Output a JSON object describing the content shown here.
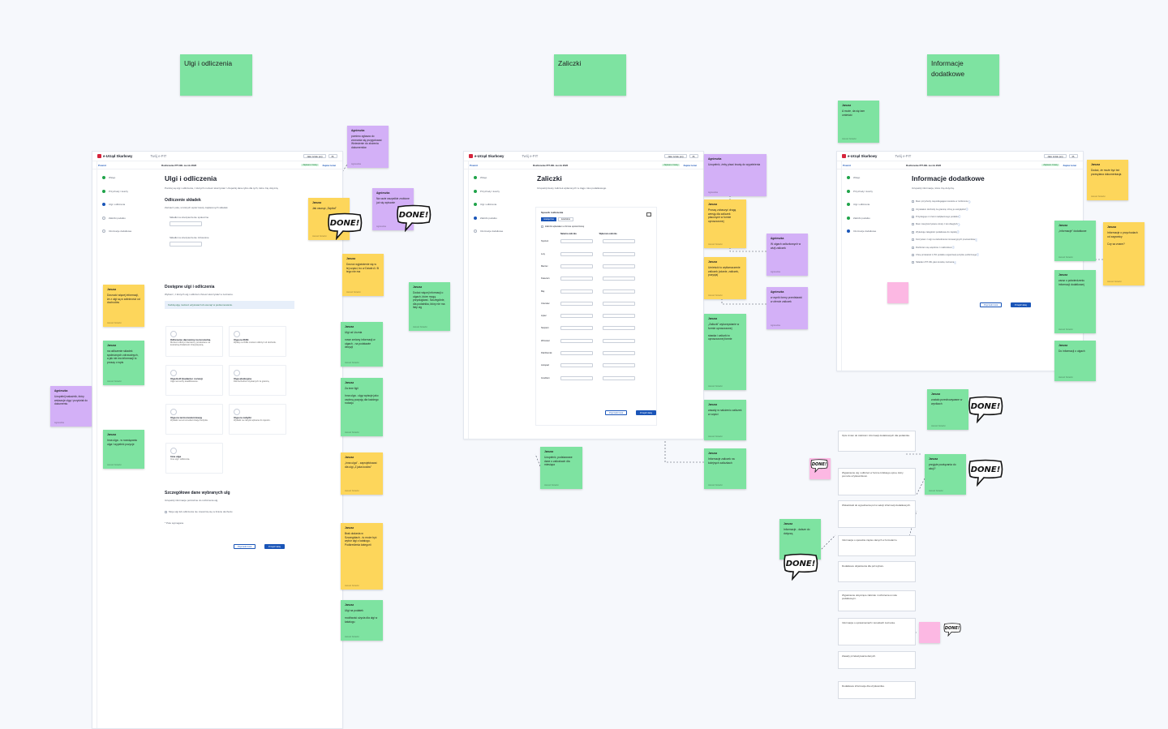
{
  "headers": {
    "ulgi": "Ulgi i odliczenia",
    "zaliczki": "Zaliczki",
    "informacje": "Informacje\ndodatkowe"
  },
  "app": {
    "logo_text": "e-Urząd Skarbowy",
    "app_name": "Twój e-PIT",
    "lang_select": "Jako ścisłe (eś)",
    "lang_select2": "PL",
    "back_link": "Powrót",
    "doc_title": "Rozliczenie PIT-36L za rok 2022",
    "saved_badge": "Zapisano zmiany",
    "help_link": "Zapisz teraz"
  },
  "sidebar": [
    "Wstęp",
    "Przychody i koszty",
    "Ulgi i odliczenia",
    "Zaliczki podatku",
    "Informacje dodatkowe"
  ],
  "ulgi_screen": {
    "title": "Ulgi i odliczenia",
    "intro": "Poniżej są ulgi i odliczenia, z których możesz skorzystać. Uzupełnij dane tylko dla tych, które Cię dotyczą.",
    "section1": "Odliczenie składek",
    "section1_text": "Zaznacz pola, w których wpisz kwoty zapłaconych składek.",
    "field1": "Składki na ubezpieczenie społeczne",
    "field2": "Składki na ubezpieczenie zdrowotne",
    "section2": "Dostępne ulgi i odliczenia",
    "section2_text": "Wybierz, z których ulg i odliczeń chcesz skorzystać w zeznaniu.",
    "info_box": "Każdą ulgę możesz edytować lub usunąć w podsumowaniu.",
    "cards": [
      {
        "title": "Odliczenie darowizny na kościelną",
        "text": "Możesz odliczyć darowizny przekazane na kościelną działalność charytatywną."
      },
      {
        "title": "Ulga na IKZE",
        "text": "Wpłaty na IKZE możesz odliczyć od dochodu."
      },
      {
        "title": "Ulga B+R (badania i rozwój)",
        "text": "Ulga na koszty kwalifikowane."
      },
      {
        "title": "Ulga abolicyjna",
        "text": "Dla dochodów uzyskanych za granicą."
      },
      {
        "title": "Ulga na termomodernizację",
        "text": "Wydatki na termomodernizację budynku."
      },
      {
        "title": "Ulga na zabytki",
        "text": "Wydatki na zabytki wpisane do rejestru."
      },
      {
        "title": "Inna ulga",
        "text": "Inne ulgi i odliczenia."
      }
    ],
    "section3": "Szczegółowe dane wybranych ulg",
    "section3_text": "Uzupełnij informacje potrzebne do rozliczenia ulg.",
    "checkbox": "Moje ulgi lub odliczenia nie mieszczą się w limicie dochodu",
    "footnote": "* Pole wymagane",
    "btn_prev": "Poprzedni krok",
    "btn_next": "Przejdź dalej"
  },
  "zaliczki_screen": {
    "title": "Zaliczki",
    "intro": "Uzupełnij kwoty zaliczek wpłaconych w ciągu roku podatkowego.",
    "sub": "Sposób rozliczenia",
    "tab1": "miesięczne",
    "tab2": "kwartalne",
    "checkbox": "Zaliczki wpłacałem w formie uproszczonej",
    "col1": "Należna zaliczka",
    "col2": "Wpłacona zaliczka",
    "months": [
      "Styczeń",
      "Luty",
      "Marzec",
      "Kwiecień",
      "Maj",
      "Czerwiec",
      "Lipiec",
      "Sierpień",
      "Wrzesień",
      "Październik",
      "Listopad",
      "Grudzień"
    ],
    "btn_prev": "Poprzedni krok",
    "btn_next": "Przejdź dalej"
  },
  "info_screen": {
    "title": "Informacje dodatkowe",
    "intro": "Uzupełnij informacje, które Cię dotyczą.",
    "options": [
      "Mam przychody niepodlegające korekcie w rozliczeniu",
      "Uzyskałem dochody za granicą i chcę je uwzględnić",
      "Przysługuje mi zwrot nadpłaconego podatku",
      "Mam niewykorzystane straty z lat ubiegłych",
      "Wykazuję zaległości podatkowe do zapłaty",
      "Korzystam z ulgi na zatrudnienie innowacyjnych pracowników",
      "Rozliczam się wspólnie z małżonkiem",
      "Chcę przekazać 1,5% podatku organizacji pożytku publicznego",
      "Składam PIT-36L jako korektę zeznania"
    ],
    "btn_prev": "Poprzedni krok",
    "btn_next": "Przejdź dalej"
  },
  "notes": [
    {
      "id": "n1",
      "color": "purple",
      "author": "Agnieszka",
      "text": "pomimo zgłasza do zeznania się przygotować Wniesienie do złożenia dokumentów",
      "foot": "Agnieszka"
    },
    {
      "id": "n2",
      "color": "yellow",
      "author": "Janusz",
      "text": "Jak usunąć „Szpital”",
      "foot": "Janusz Kotecki"
    },
    {
      "id": "n3",
      "color": "purple",
      "author": "Agnieszka",
      "text": "Na razie wszystkie zrobione już się wpisanie",
      "foot": "Agnieszka"
    },
    {
      "id": "n4",
      "color": "yellow",
      "author": "Janusz",
      "text": "Dorzuć wyjaśnienie się w tej części, bo w Dziale A i B tego nie ma",
      "foot": "Janusz Kotecki"
    },
    {
      "id": "n5",
      "color": "yellow",
      "author": "Janusz",
      "text": "Dorzucić więcej informacji, że z ulgi są w zależności od dochodów",
      "foot": "Janusz Kotecki"
    },
    {
      "id": "n6",
      "color": "green",
      "author": "Janusz",
      "text": "Dodać więcej informacji o ulgach, które mogą przysługiwać. Szczególnie, dla podatnika, który nie ma listy ulg",
      "foot": "Janusz Kotecki"
    },
    {
      "id": "n7",
      "color": "green",
      "author": "Janusz",
      "text": "na odliczenie składek społecznych zdrowotnych, a jak nie ma informacji to proszę o wpis",
      "foot": "Janusz Kotecki"
    },
    {
      "id": "n8",
      "color": "green",
      "author": "Janusz",
      "text": "Ulgi od Ucznia\n\nnowe zmiany informacji w ulgach - na podstawie decyzji",
      "foot": "Janusz Kotecki"
    },
    {
      "id": "n9",
      "color": "purple",
      "author": "Agnieszka",
      "text": "Uzupełnij wskaźnik, który wskazuje ulgę i przydział do dokumentu",
      "foot": "Agnieszka"
    },
    {
      "id": "n10",
      "color": "green",
      "author": "Janusz",
      "text": "Inna ulga - w rozwiązaniu ulga i wypełnić pozycje",
      "foot": "Janusz Kotecki"
    },
    {
      "id": "n11",
      "color": "green",
      "author": "Janusz",
      "text": "Za inne ligii\n\nInna ulga - ulgę wpisuje jako osobną pozycję dla każdego rodzaju",
      "foot": "Janusz Kotecki"
    },
    {
      "id": "n12",
      "color": "yellow",
      "author": "Janusz",
      "text": "„Inna ulga” - zaprojektować dla ulgi „Z jaka kodów”",
      "foot": "Janusz Kotecki"
    },
    {
      "id": "n13",
      "color": "yellow",
      "author": "Janusz",
      "text": "Brak dodania w Szczegółach - tu może być wybór ulgi z katalogu. Podkreślenia kategorii",
      "foot": "Janusz Kotecki"
    },
    {
      "id": "n14",
      "color": "green",
      "author": "Janusz",
      "text": "Ulgi na podatek\n\nmożliwość użycia dla ulgi w katalogu",
      "foot": "Janusz Kotecki"
    },
    {
      "id": "n15",
      "color": "purple",
      "author": "Agnieszka",
      "text": "Uzupełnić, żeby pisać kwotę do wypełnienia",
      "foot": "Agnieszka"
    },
    {
      "id": "n16",
      "color": "yellow",
      "author": "Janusz",
      "text": "Proszę zobaczyć drugą wersję dla zaliczek płaconych w formie uproszczonej",
      "foot": "Janusz Kotecki"
    },
    {
      "id": "n17",
      "color": "yellow",
      "author": "Janusz",
      "text": "Umieścić to wytłumaczenie zaliczek (zdanie, zaliczek, pozycja)",
      "foot": "Janusz Kotecki"
    },
    {
      "id": "n18",
      "color": "purple",
      "author": "Agnieszka",
      "text": "W ulgach zaliczkowych w wizji zaliczek",
      "foot": "Agnieszka"
    },
    {
      "id": "n19",
      "color": "purple",
      "author": "Agnieszka",
      "text": "w wynik formy przedstawić w ofercie zaliczek",
      "foot": "Agnieszka"
    },
    {
      "id": "n20",
      "color": "green",
      "author": "Janusz",
      "text": "„Zaliczki” wykorzystanie w formie uproszczonej\n\nstawka i zaliczki w uproszczonej formie",
      "foot": "Janusz Kotecki"
    },
    {
      "id": "n21",
      "color": "green",
      "author": "Janusz",
      "text": "zasady w nałożeniu zaliczek w części",
      "foot": "Janusz Kotecki"
    },
    {
      "id": "n22",
      "color": "green",
      "author": "Janusz",
      "text": "Informacje zaliczek na kolejnych zaliczkach",
      "foot": "Janusz Kotecki"
    },
    {
      "id": "n23",
      "color": "green",
      "author": "Janusz",
      "text": "Uzupełnić, podstawowe dane o zaliczkach dla miesiąca",
      "foot": "Janusz Kotecki"
    },
    {
      "id": "n24",
      "color": "green",
      "author": "Janusz",
      "text": "A może, da się tam umieścić",
      "foot": "Janusz Kotecki"
    },
    {
      "id": "n25",
      "color": "yellow",
      "author": "Janusz",
      "text": "Dodać, że może być też przesyłana dokumentacja",
      "foot": "Janusz Kotecki"
    },
    {
      "id": "n26",
      "color": "green",
      "author": "Janusz",
      "text": "„Informacje” dodatkowe",
      "foot": "Janusz Kotecki"
    },
    {
      "id": "n27",
      "color": "yellow",
      "author": "Janusz",
      "text": "Informacje o przychodach od zagranicy\n\nCzy sa znane?",
      "foot": "Janusz Kotecki"
    },
    {
      "id": "n28",
      "color": "green",
      "author": "Janusz",
      "text": "zaraz o potwierdzeniu informacji dodatkowej",
      "foot": "Janusz Kotecki"
    },
    {
      "id": "n29",
      "color": "green",
      "author": "Janusz",
      "text": "Do informacji o ulgach",
      "foot": "Janusz Kotecki"
    },
    {
      "id": "n30",
      "color": "green",
      "author": "Janusz",
      "text": "zostało przechowywane w wynikach",
      "foot": "Janusz Kotecki"
    },
    {
      "id": "n31",
      "color": "green",
      "author": "Janusz",
      "text": "przyjęte powiązania do akcji?",
      "foot": "Janusz Kotecki"
    },
    {
      "id": "n32",
      "color": "green",
      "author": "Janusz",
      "text": "Informacje - dalsze do dotyczą",
      "foot": "Janusz Kotecki"
    },
    {
      "id": "n33",
      "color": "pink",
      "author": "",
      "text": "",
      "foot": ""
    },
    {
      "id": "n34",
      "color": "pink",
      "author": "",
      "text": "",
      "foot": ""
    },
    {
      "id": "n35",
      "color": "pink",
      "author": "",
      "text": "",
      "foot": ""
    }
  ],
  "white_notes": [
    "Opis zmian do zaliczek i informacji dodatkowych dla podatnika.",
    "Wyjaśnienie ulg i odliczeń w formie krótkiego opisu, który pomoże użytkownikowi.",
    "Wskazówki do wypełnienia pól w sekcji informacji dodatkowych.",
    "Informacja o sposobie zapisu danych w formularzu.",
    "Dodatkowe objaśnienia dla pól wyboru.",
    "Wyjaśnienie dotyczące zaliczek i rozliczenia w roku podatkowym.",
    "Informacja o uprawnieniach i korektach zeznania.",
    "Zasady przekazywania danych.",
    "Dodatkowe informacje dla użytkownika."
  ],
  "done_label": "DONE!"
}
